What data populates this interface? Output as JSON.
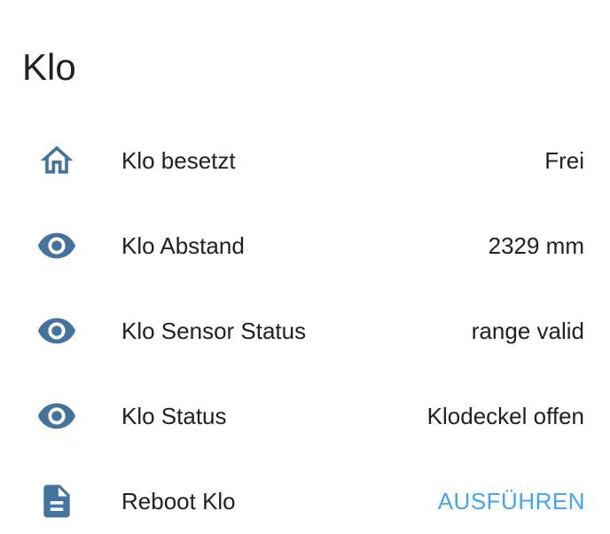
{
  "card": {
    "title": "Klo"
  },
  "entities": [
    {
      "icon": "home-icon",
      "name": "Klo besetzt",
      "state": "Frei"
    },
    {
      "icon": "eye-icon",
      "name": "Klo Abstand",
      "state": "2329 mm"
    },
    {
      "icon": "eye-icon",
      "name": "Klo Sensor Status",
      "state": "range valid"
    },
    {
      "icon": "eye-icon",
      "name": "Klo Status",
      "state": "Klodeckel offen"
    },
    {
      "icon": "file-document-icon",
      "name": "Reboot Klo",
      "action_label": "AUSFÜHREN"
    }
  ],
  "colors": {
    "icon": "#44739e",
    "accent": "#42a5f5",
    "text": "#212121"
  }
}
